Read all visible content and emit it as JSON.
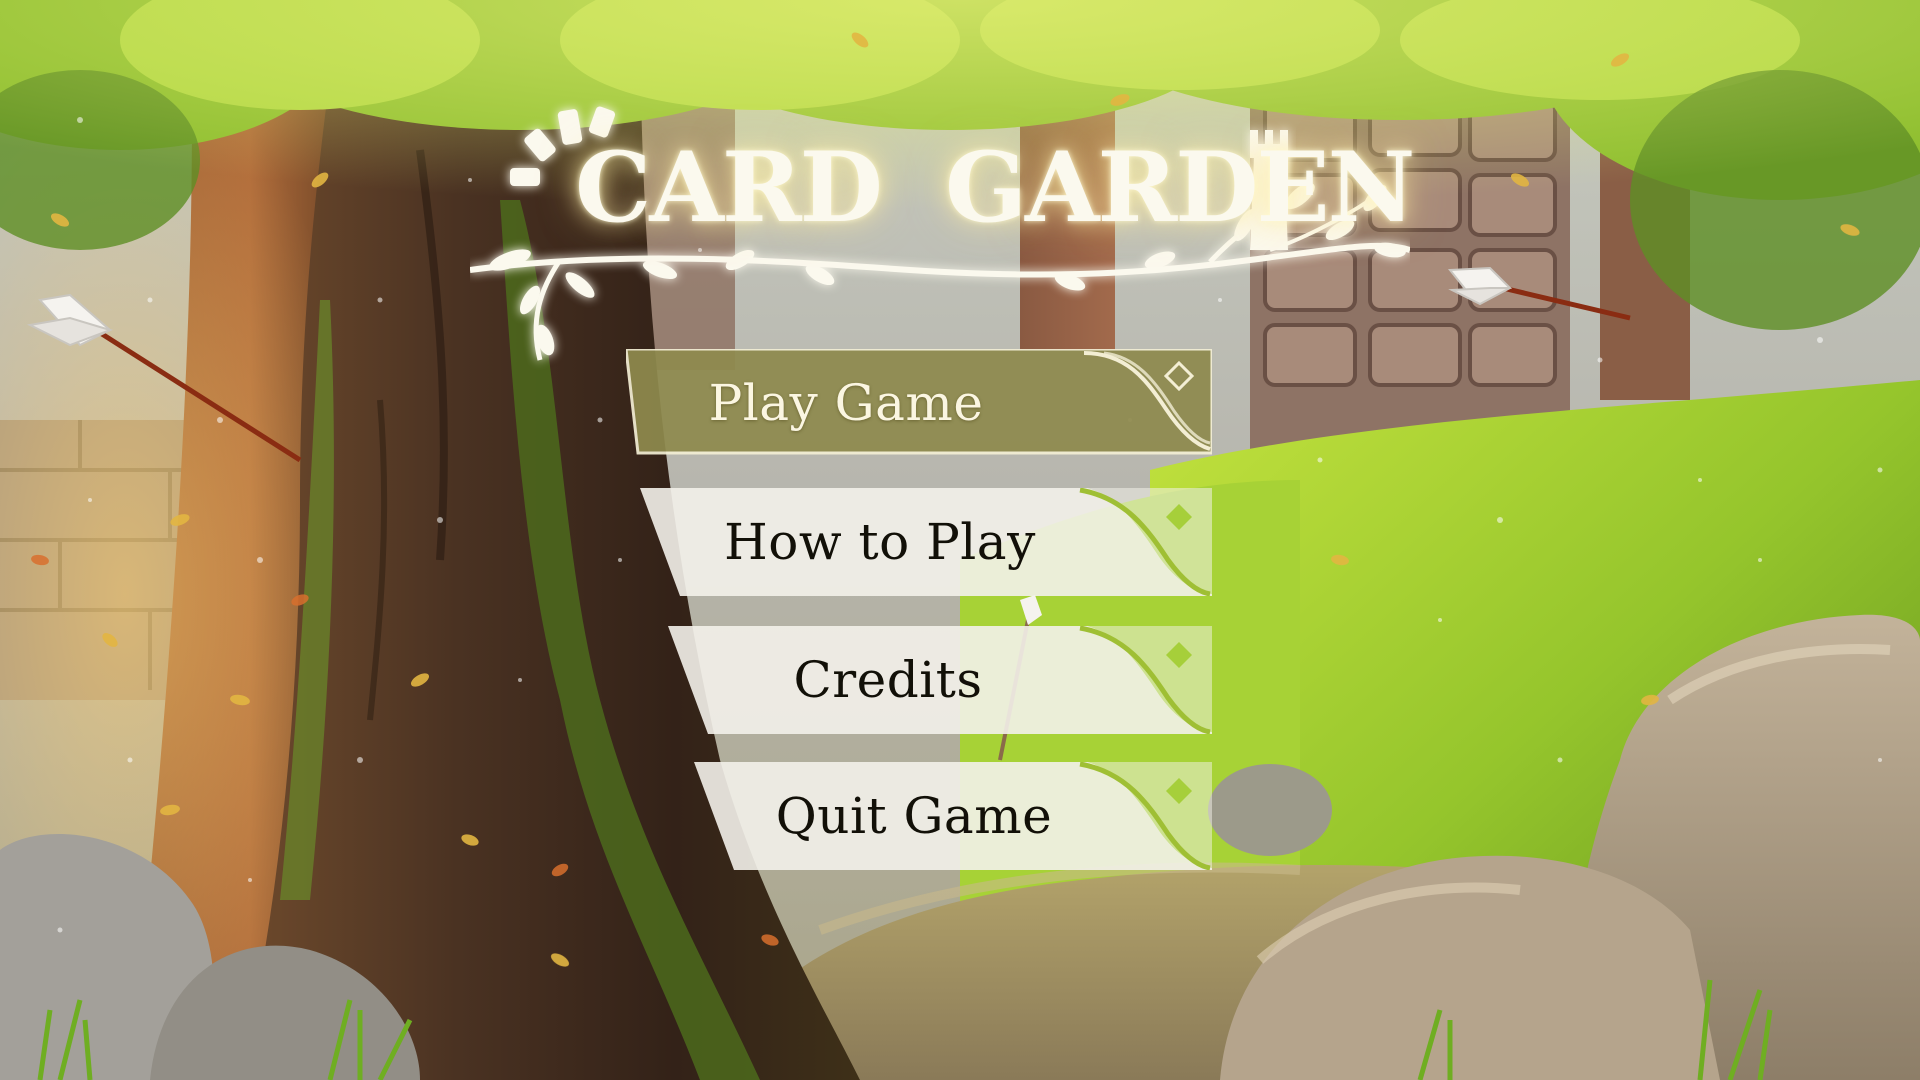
{
  "game": {
    "title_part1": "CARD",
    "title_part2": "GARDEN"
  },
  "menu": {
    "items": [
      {
        "label": "Play Game",
        "selected": true
      },
      {
        "label": "How to Play",
        "selected": false
      },
      {
        "label": "Credits",
        "selected": false
      },
      {
        "label": "Quit Game",
        "selected": false
      }
    ]
  },
  "colors": {
    "selected_button": "#8f8a4e",
    "button_plate": "#f3f1ea",
    "title_glow": "#fff3b8",
    "foliage": "#a8d23a"
  },
  "icons": {
    "logo_left": "sun-rays-icon",
    "logo_right": "tower-icon",
    "button_corner": "diamond-icon"
  }
}
